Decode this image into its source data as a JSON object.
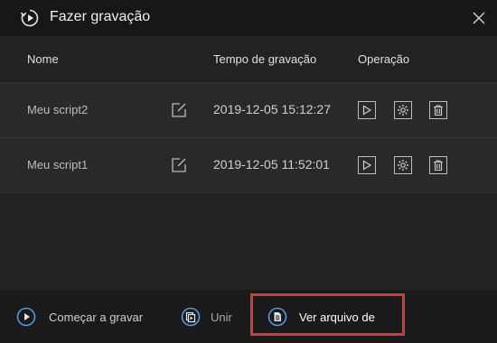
{
  "dialog": {
    "title": "Fazer gravação",
    "icons": {
      "title": "record-script-icon",
      "close": "close-icon"
    }
  },
  "table": {
    "headers": {
      "name": "Nome",
      "time": "Tempo de gravação",
      "operation": "Operação"
    },
    "rows": [
      {
        "name": "Meu script2",
        "time": "2019-12-05 15:12:27"
      },
      {
        "name": "Meu script1",
        "time": "2019-12-05 11:52:01"
      }
    ],
    "icons": {
      "edit": "edit-icon",
      "play": "play-icon",
      "settings": "gear-icon",
      "delete": "trash-icon"
    }
  },
  "footer": {
    "start_label": "Começar a gravar",
    "merge_label": "Unir",
    "view_label": "Ver arquivo de",
    "icons": {
      "start": "play-circle-icon",
      "merge": "merge-icon",
      "view": "document-icon"
    }
  },
  "colors": {
    "accent": "#4a9ce8",
    "highlight": "#d43a3a",
    "background": "#222222",
    "row_background": "#292929"
  }
}
